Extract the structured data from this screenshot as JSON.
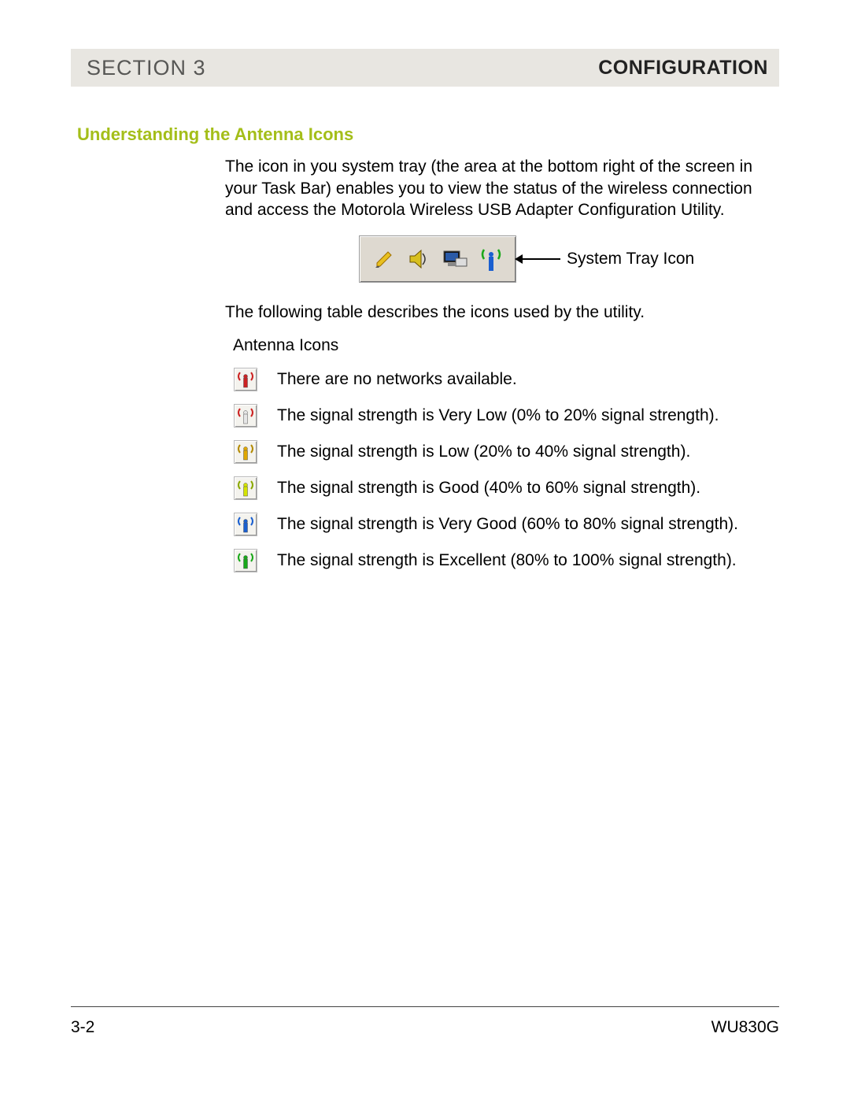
{
  "header": {
    "section_label": "SECTION 3",
    "title": "CONFIGURATION"
  },
  "subheading": "Understanding the Antenna Icons",
  "intro_text": "The icon in you system tray (the area at the bottom right of the screen in your Task Bar) enables you to view the status of the wireless connection and access the Motorola Wireless USB Adapter Configuration Utility.",
  "tray_callout_label": "System Tray Icon",
  "following_text": "The following table describes the icons used by the utility.",
  "table_title": "Antenna Icons",
  "icons": [
    {
      "name": "antenna-none-icon",
      "waves": "#cc2222",
      "body": "#cc2222",
      "desc": "There are no networks available."
    },
    {
      "name": "antenna-very-low-icon",
      "waves": "#cc2222",
      "body": "#e6e6e6",
      "desc": "The signal strength is Very Low (0% to 20% signal strength)."
    },
    {
      "name": "antenna-low-icon",
      "waves": "#b38a00",
      "body": "#e0a800",
      "desc": "The signal strength is Low (20% to 40% signal strength)."
    },
    {
      "name": "antenna-good-icon",
      "waves": "#8aa800",
      "body": "#d4e400",
      "desc": "The signal strength is Good (40% to 60% signal strength)."
    },
    {
      "name": "antenna-very-good-icon",
      "waves": "#1a5fd0",
      "body": "#1a5fd0",
      "desc": "The signal strength is Very Good (60% to 80% signal strength)."
    },
    {
      "name": "antenna-excellent-icon",
      "waves": "#18a818",
      "body": "#18a818",
      "desc": "The signal strength is Excellent (80% to 100% signal strength)."
    }
  ],
  "footer": {
    "page": "3-2",
    "model": "WU830G"
  }
}
